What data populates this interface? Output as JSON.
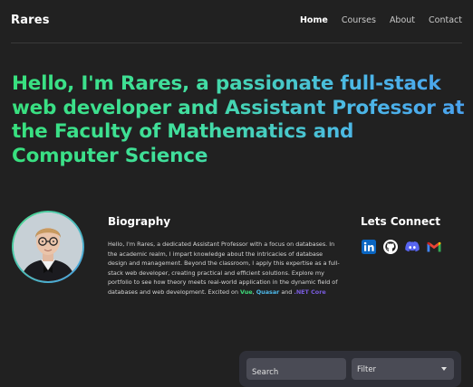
{
  "nav": {
    "brand": "Rares",
    "links": [
      {
        "label": "Home",
        "active": true
      },
      {
        "label": "Courses",
        "active": false
      },
      {
        "label": "About",
        "active": false
      },
      {
        "label": "Contact",
        "active": false
      }
    ]
  },
  "hero": {
    "headline": "Hello, I'm Rares, a passionate full-stack web developer and Assistant Professor at the Faculty of Mathematics and Computer Science",
    "gradient_colors": [
      "#38e07e",
      "#4aa2ee"
    ]
  },
  "biography": {
    "title": "Biography",
    "text": "Hello, I'm Rares, a dedicated Assistant Professor with a focus on databases. In the academic realm, I impart knowledge about the intricacies of database design and management. Beyond the classroom, I apply this expertise as a full-stack web developer, creating practical and efficient solutions. Explore my portfolio to see how theory meets real-world application in the dynamic field of databases and web development. Excited on ",
    "tech1": "Vue",
    "sep1": ", ",
    "tech2": "Quasar",
    "sep2": " and ",
    "tech3": ".NET Core"
  },
  "connect": {
    "title": "Lets Connect",
    "icons": [
      "linkedin-icon",
      "github-icon",
      "discord-icon",
      "gmail-icon"
    ]
  },
  "filters": {
    "search_placeholder": "Search",
    "filter_label": "Filter"
  }
}
